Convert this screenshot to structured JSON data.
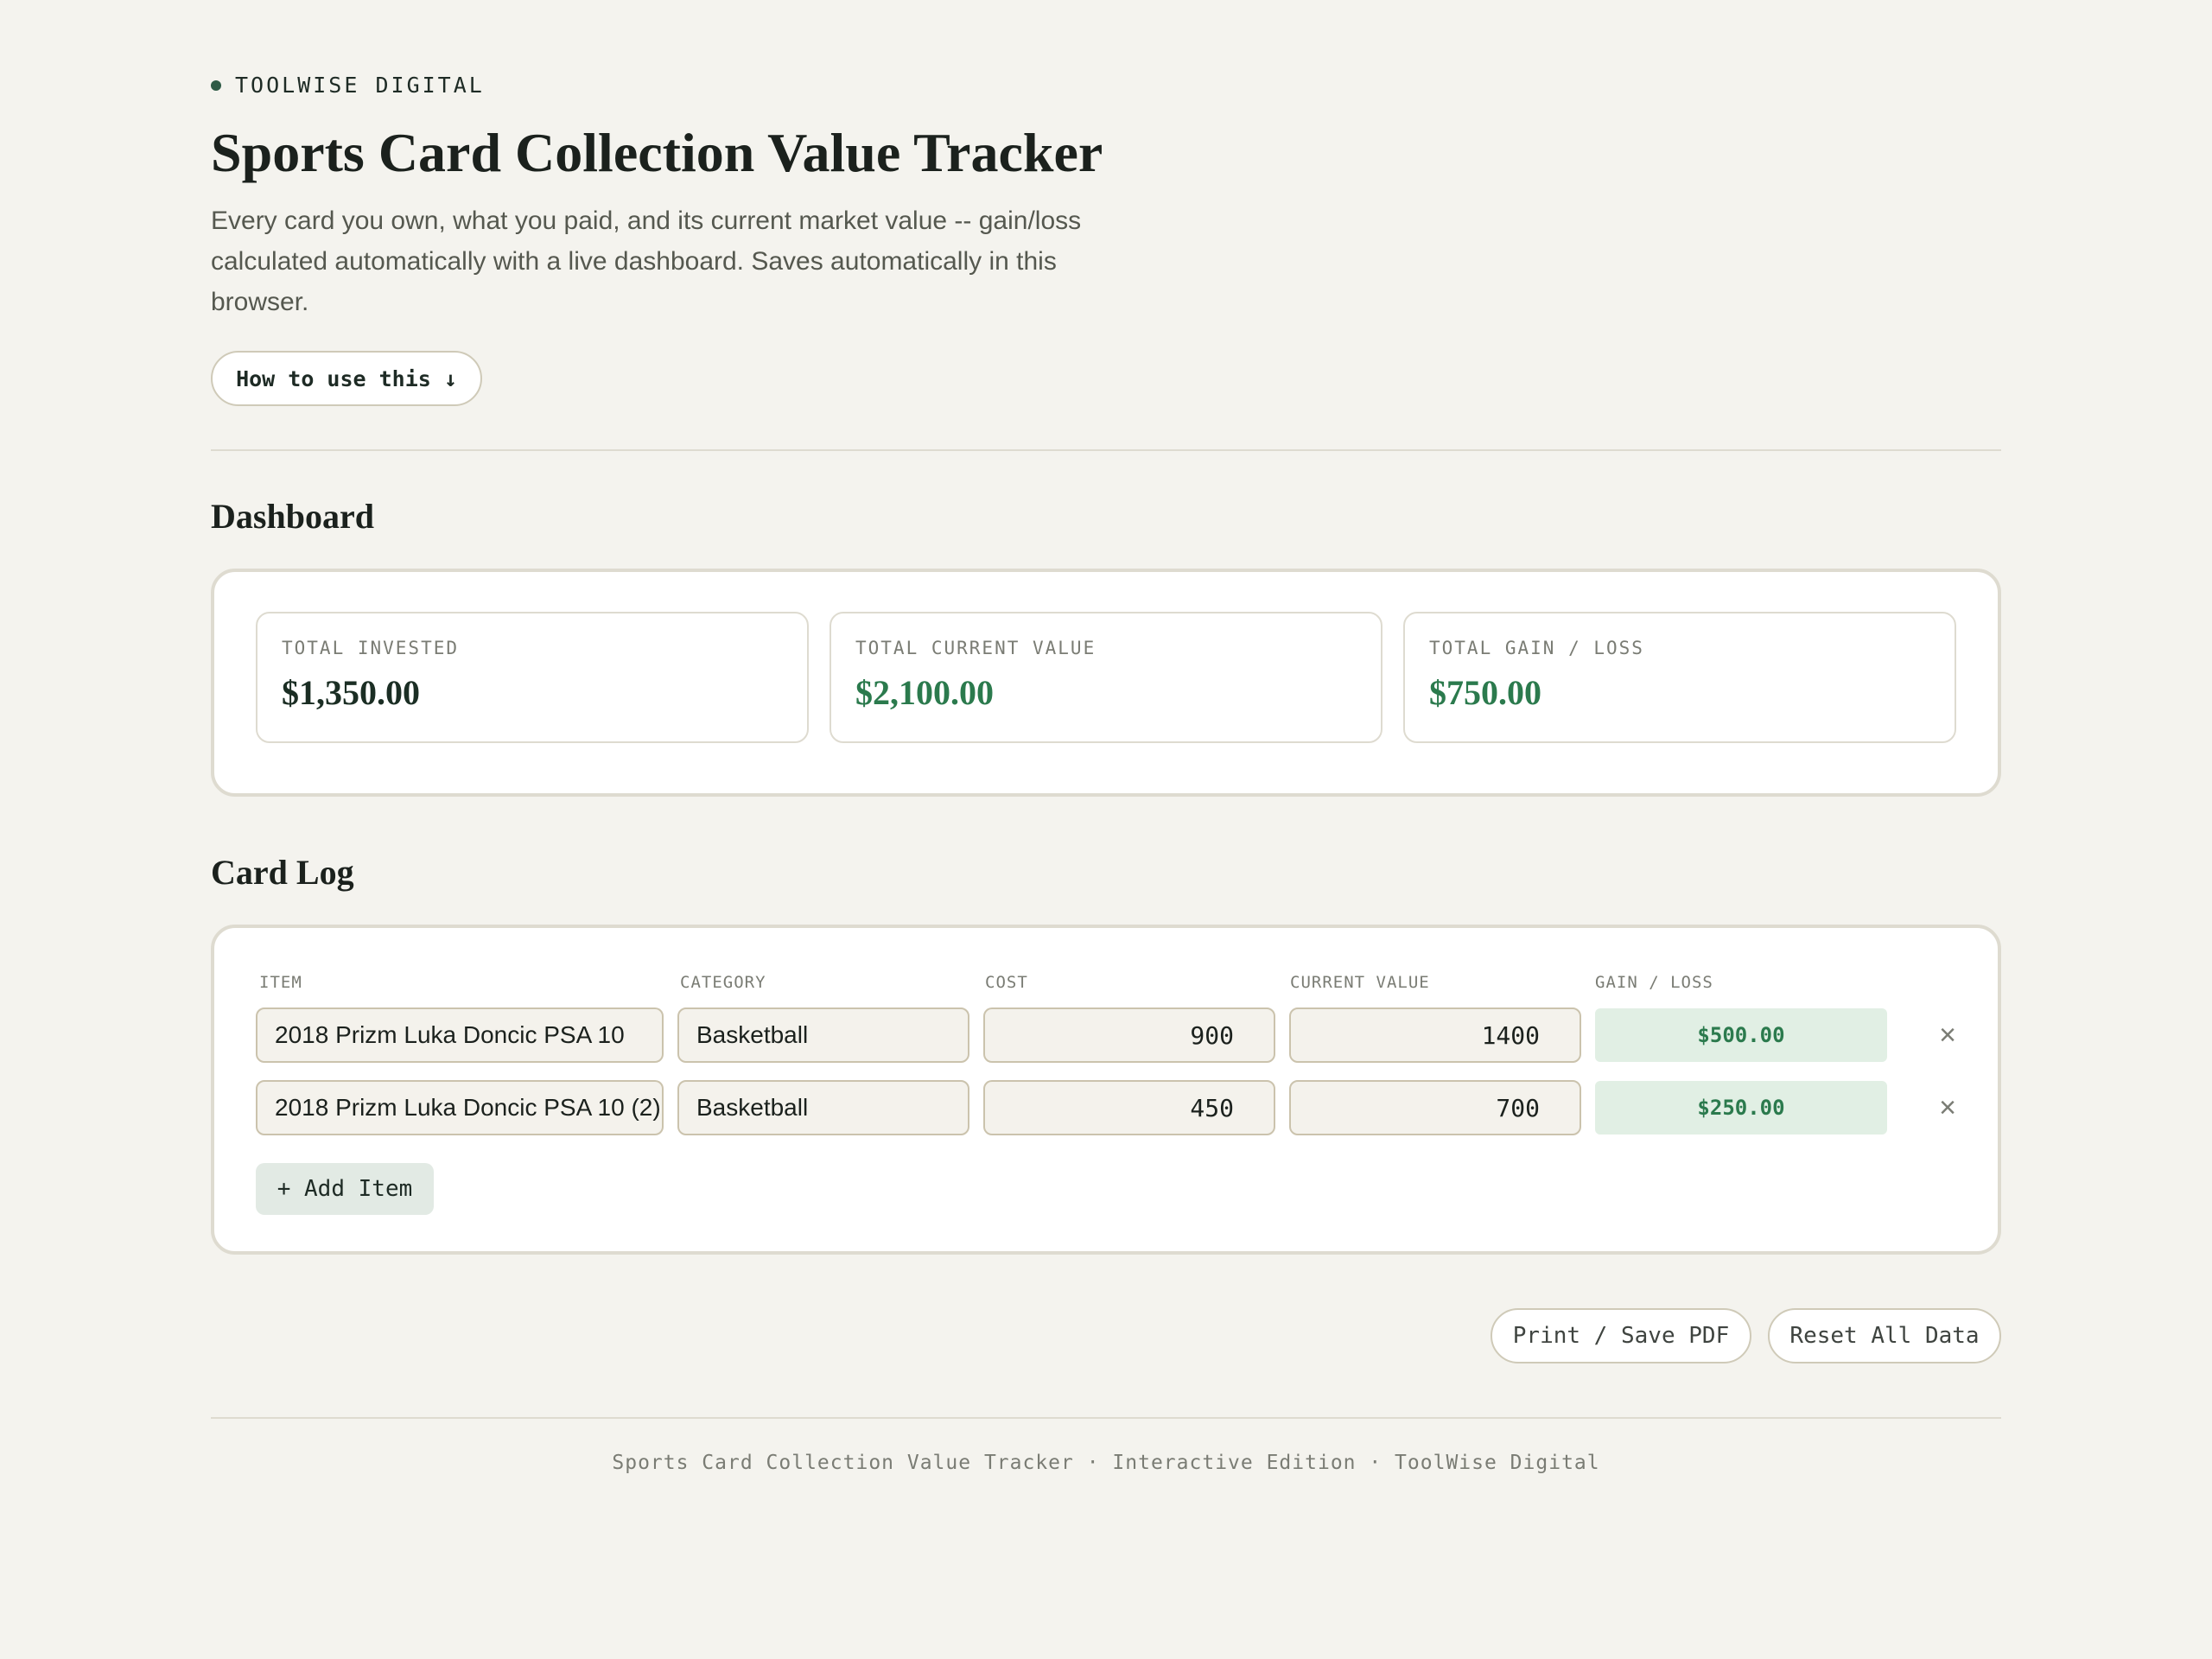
{
  "brand": {
    "name": "TOOLWISE DIGITAL"
  },
  "header": {
    "title": "Sports Card Collection Value Tracker",
    "subtitle": "Every card you own, what you paid, and its current market value -- gain/loss calculated automatically with a live dashboard. Saves automatically in this browser.",
    "how_to_label": "How to use this ↓"
  },
  "dashboard": {
    "heading": "Dashboard",
    "stats": [
      {
        "label": "TOTAL INVESTED",
        "value": "$1,350.00",
        "color": "#1b2e24"
      },
      {
        "label": "TOTAL CURRENT VALUE",
        "value": "$2,100.00",
        "color": "#2b7a4d"
      },
      {
        "label": "TOTAL GAIN / LOSS",
        "value": "$750.00",
        "color": "#2b7a4d"
      }
    ]
  },
  "card_log": {
    "heading": "Card Log",
    "columns": [
      "ITEM",
      "CATEGORY",
      "COST",
      "CURRENT VALUE",
      "GAIN / LOSS"
    ],
    "rows": [
      {
        "item": "2018 Prizm Luka Doncic PSA 10",
        "category": "Basketball",
        "cost": "900",
        "current_value": "1400",
        "gain": "$500.00"
      },
      {
        "item": "2018 Prizm Luka Doncic PSA 10 (2)",
        "category": "Basketball",
        "cost": "450",
        "current_value": "700",
        "gain": "$250.00"
      }
    ],
    "remove_icon": "×",
    "add_label": "+ Add Item"
  },
  "actions": {
    "print_label": "Print / Save PDF",
    "reset_label": "Reset All Data"
  },
  "footer": {
    "text": "Sports Card Collection Value Tracker · Interactive Edition · ToolWise Digital"
  }
}
